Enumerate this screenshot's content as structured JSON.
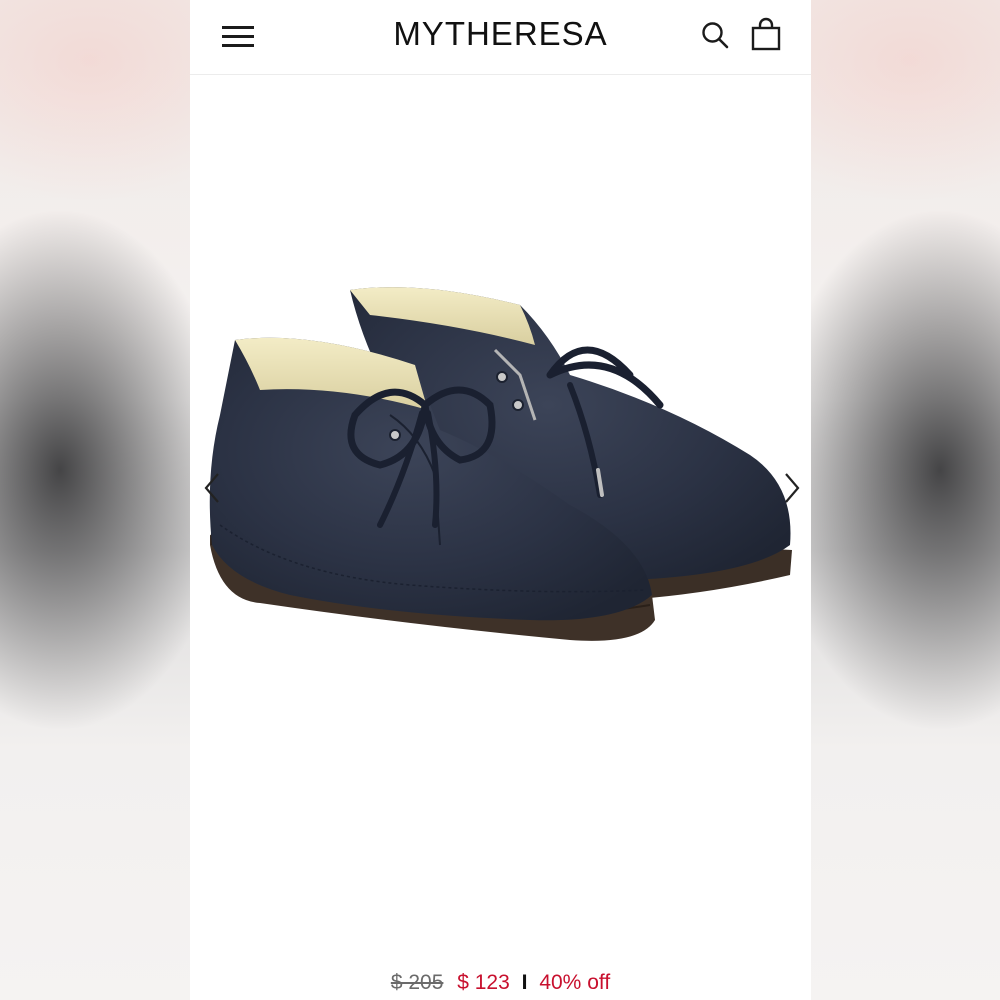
{
  "header": {
    "logo": "MYTHERESA",
    "icons": {
      "menu": "hamburger-menu-icon",
      "search": "search-icon",
      "bag": "shopping-bag-icon"
    }
  },
  "product": {
    "image": "navy suede lace-up desert boots",
    "color": "#2a3140",
    "prev_icon": "chevron-left-icon",
    "next_icon": "chevron-right-icon"
  },
  "pricing": {
    "original_price": "$ 205",
    "sale_price": "$ 123",
    "separator": "I",
    "discount": "40% off",
    "sale_color": "#c8102e"
  }
}
